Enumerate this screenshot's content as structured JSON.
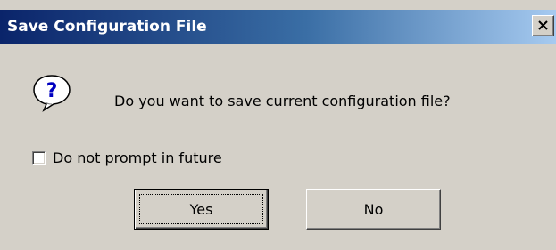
{
  "dialog": {
    "title": "Save Configuration File",
    "message": "Do you want to save current configuration file?",
    "icon": "question-icon",
    "checkbox": {
      "label": "Do not prompt in future",
      "checked": false
    },
    "buttons": {
      "yes_label": "Yes",
      "no_label": "No",
      "default": "Yes"
    }
  },
  "colors": {
    "title_gradient_start": "#0a246a",
    "title_gradient_end": "#a6caf0",
    "face": "#d4d0c8",
    "title_text": "#ffffff"
  }
}
